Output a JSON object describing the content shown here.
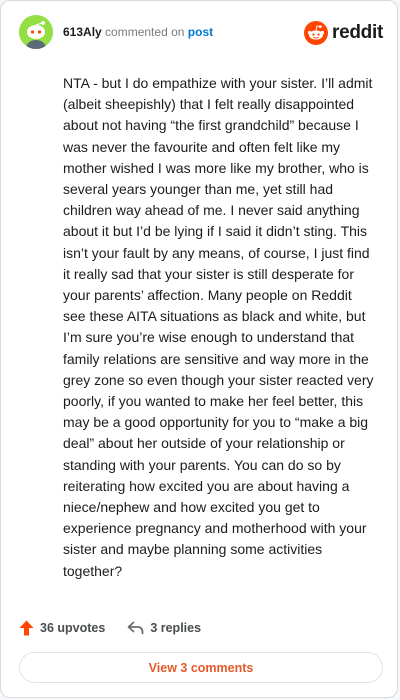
{
  "header": {
    "username": "613Aly",
    "action_text": "commented on",
    "post_label": "post",
    "brand": "reddit"
  },
  "comment": {
    "body": "NTA - but I do empathize with your sister. I’ll admit (albeit sheepishly) that I felt really disappointed about not having “the first grandchild” because I was never the favourite and often felt like my mother wished I was more like my brother, who is several years younger than me, yet still had children way ahead of me. I never said anything about it but I’d be lying if I said it didn’t sting. This isn’t your fault by any means, of course, I just find it really sad that your sister is still desperate for your parents’ affection. Many people on Reddit see these AITA situations as black and white, but I’m sure you’re wise enough to understand that family relations are sensitive and way more in the grey zone so even though your sister reacted very poorly, if you wanted to make her feel better, this may be a good opportunity for you to “make a big deal” about her outside of your relationship or standing with your parents. You can do so by reiterating how excited you are about having a niece/nephew and how excited you get to experience pregnancy and motherhood with your sister and maybe planning some activities together?"
  },
  "actions": {
    "upvotes": "36 upvotes",
    "replies": "3 replies"
  },
  "footer": {
    "view_comments": "View 3 comments"
  },
  "colors": {
    "accent": "#ff4500",
    "link": "#0079d3",
    "avatar_bg": "#94e044"
  },
  "icons": {
    "avatar": "snoo-avatar",
    "brand": "reddit-logo-icon",
    "upvote": "upvote-arrow-icon",
    "reply": "reply-arrow-icon"
  }
}
